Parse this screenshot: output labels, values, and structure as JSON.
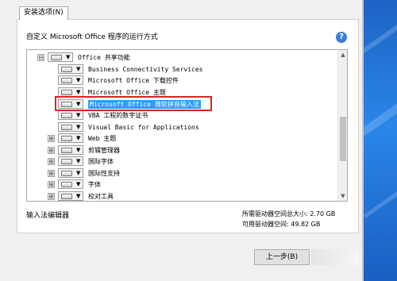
{
  "tab": {
    "label": "安装选项(N)"
  },
  "heading": "自定义 Microsoft Office 程序的运行方式",
  "help_icon": {
    "glyph": "?",
    "color": "#3b7fd4"
  },
  "tree": {
    "rows": [
      {
        "label": "Office 共享功能",
        "expander": "⊟",
        "level": 0
      },
      {
        "label": "Business Connectivity Services",
        "expander": "",
        "level": 1
      },
      {
        "label": "Microsoft Office 下载控件",
        "expander": "",
        "level": 1
      },
      {
        "label": "Microsoft Office 主题",
        "expander": "",
        "level": 1
      },
      {
        "label": "Microsoft Office 微软拼音输入法",
        "expander": "",
        "level": 1,
        "selected": true
      },
      {
        "label": "VBA 工程的数字证书",
        "expander": "",
        "level": 1
      },
      {
        "label": "Visual Basic for Applications",
        "expander": "",
        "level": 1
      },
      {
        "label": "Web 主题",
        "expander": "⊞",
        "level": 1
      },
      {
        "label": "剪辑管理器",
        "expander": "⊞",
        "level": 1
      },
      {
        "label": "国际字体",
        "expander": "⊞",
        "level": 1
      },
      {
        "label": "国际性支持",
        "expander": "⊞",
        "level": 1
      },
      {
        "label": "字体",
        "expander": "⊞",
        "level": 1
      },
      {
        "label": "校对工具",
        "expander": "⊞",
        "level": 1
      }
    ]
  },
  "description": "输入法编辑器",
  "space_required": "所需驱动器空间总大小: 2.70 GB",
  "space_available": "可用驱动器空间: 49.82 GB",
  "buttons": {
    "back": "上一步(B)"
  },
  "colors": {
    "selection": "#3399ff",
    "highlight_box": "#e02020",
    "desktop": "#2a86e8"
  }
}
